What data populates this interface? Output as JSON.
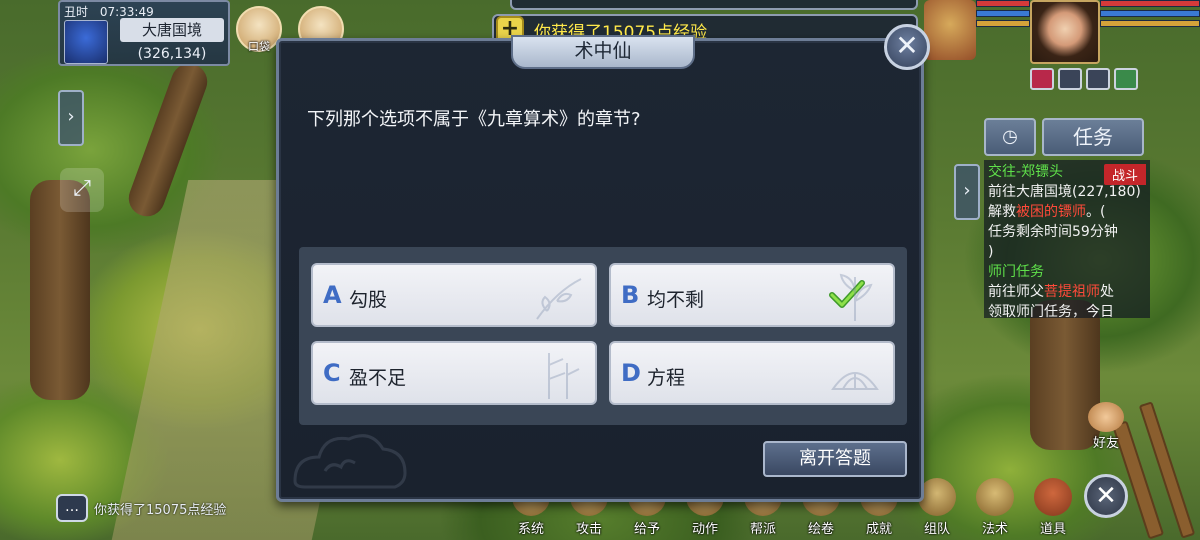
{
  "hud": {
    "time_slot": "丑时",
    "clock": "07:33:49",
    "zone_name": "大唐国境",
    "coords": "(326,134)",
    "bag_label": "口袋"
  },
  "notice": {
    "exp_message": "你获得了15075点经验"
  },
  "quiz": {
    "title": "术中仙",
    "question": "下列那个选项不属于《九章算术》的章节?",
    "options": [
      {
        "letter": "A",
        "text": "勾股",
        "correct": false
      },
      {
        "letter": "B",
        "text": "均不剩",
        "correct": true
      },
      {
        "letter": "C",
        "text": "盈不足",
        "correct": false
      },
      {
        "letter": "D",
        "text": "方程",
        "correct": false
      }
    ],
    "leave_label": "离开答题",
    "accent_color": "#3f6cc4"
  },
  "quest": {
    "tab_label": "任务",
    "entries": [
      {
        "title": "交往-郑镖头",
        "tag": "战斗",
        "line1": "前往大唐国境(227,180)",
        "line2_pre": "解救",
        "line2_red": "被困的镖师",
        "line2_post": "。(",
        "line3": "任务剩余时间59分钟",
        "line4": ")"
      },
      {
        "title": "师门任务",
        "line1_pre": "前往师父",
        "line1_red": "菩提祖师",
        "line1_post": "处",
        "line2": "领取师门任务，今日"
      }
    ]
  },
  "chat": {
    "last_message": "你获得了15075点经验"
  },
  "bottom_menu": [
    "系统",
    "攻击",
    "给予",
    "动作",
    "帮派",
    "绘卷",
    "成就",
    "组队",
    "法术",
    "道具"
  ],
  "side": {
    "friends_label": "好友"
  }
}
